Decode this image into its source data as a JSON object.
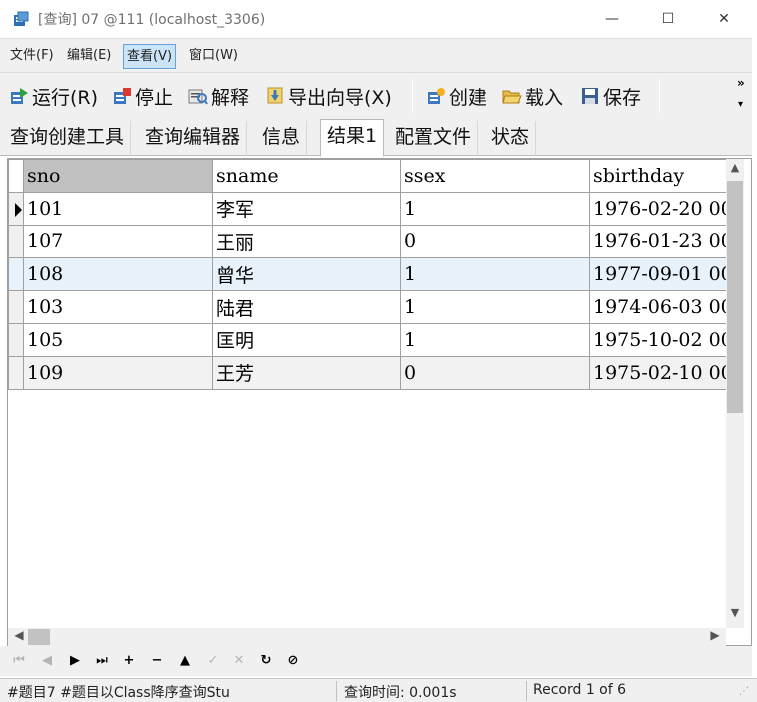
{
  "window": {
    "title": "[查询] 07 @111 (localhost_3306)",
    "min_glyph": "—",
    "max_glyph": "☐",
    "close_glyph": "✕"
  },
  "menu": {
    "file": "文件(F)",
    "edit": "编辑(E)",
    "view": "查看(V)",
    "window": "窗口(W)"
  },
  "toolbar": {
    "run": "运行(R)",
    "stop": "停止",
    "explain": "解释",
    "export": "导出向导(X)",
    "create": "创建",
    "load": "载入",
    "save": "保存",
    "more": "»"
  },
  "tabs": [
    "查询创建工具",
    "查询编辑器",
    "信息",
    "结果1",
    "配置文件",
    "状态"
  ],
  "grid": {
    "columns": [
      "sno",
      "sname",
      "ssex",
      "sbirthday"
    ],
    "rows": [
      [
        "101",
        "李军",
        "1",
        "1976-02-20 00"
      ],
      [
        "107",
        "王丽",
        "0",
        "1976-01-23 00"
      ],
      [
        "108",
        "曾华",
        "1",
        "1977-09-01 00"
      ],
      [
        "103",
        "陆君",
        "1",
        "1974-06-03 00"
      ],
      [
        "105",
        "匡明",
        "1",
        "1975-10-02 00"
      ],
      [
        "109",
        "王芳",
        "0",
        "1975-02-10 00"
      ]
    ]
  },
  "status": {
    "query_text": "#题目7 #题目以Class降序查询Stu",
    "query_time": "查询时间: 0.001s",
    "record": "Record 1 of 6"
  },
  "colors": {
    "chrome": "#f0f0f0",
    "selected_row": "#e8f2fb",
    "active_menu": "#cce4f7"
  }
}
